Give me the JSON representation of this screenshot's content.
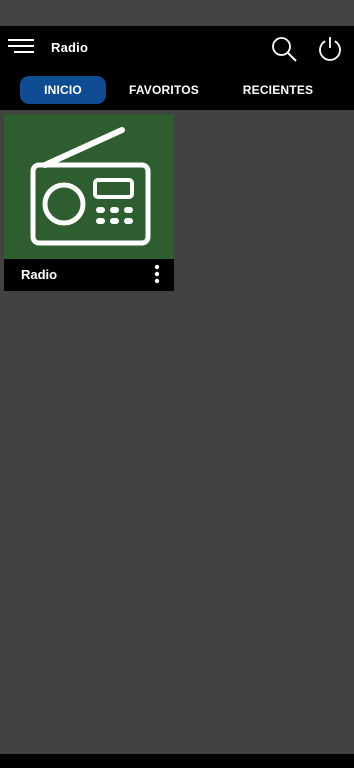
{
  "app_bar": {
    "title": "Radio",
    "menu_icon": "hamburger-menu-icon",
    "search_icon": "search-icon",
    "power_icon": "power-icon"
  },
  "tabs": [
    {
      "label": "INICIO",
      "active": true
    },
    {
      "label": "FAVORITOS",
      "active": false
    },
    {
      "label": "RECIENTES",
      "active": false
    }
  ],
  "stations": [
    {
      "title": "Radio",
      "icon": "radio-icon",
      "more_icon": "more-vert-icon"
    }
  ],
  "colors": {
    "background": "#424242",
    "bar": "#000000",
    "active_tab": "#0f4c91",
    "card_image": "#2e5e30",
    "text": "#ffffff"
  }
}
